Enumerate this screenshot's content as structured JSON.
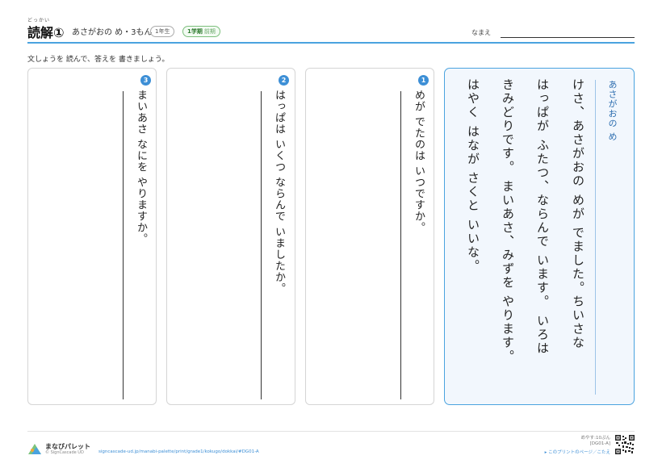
{
  "header": {
    "title_ruby": "どっかい",
    "title": "読解①",
    "subtitle": "あさがおの め・3もん",
    "grade": "1年生",
    "term": "1学期",
    "term_sub": "前期",
    "name_label": "なまえ"
  },
  "instruction": "文しょうを 読んで、答えを 書きましょう。",
  "story": {
    "title": "あさがおの め",
    "lines": [
      "けさ、あさがおの めが でました。ちいさな",
      "はっぱが ふたつ、ならんで います。 いろは",
      "きみどりです。 まいあさ、みずを やります。",
      "はやく はなが さくと いいな。"
    ]
  },
  "questions": [
    {
      "number": "1",
      "text": "めが でたのは いつですか。"
    },
    {
      "number": "2",
      "text": "はっぱは いくつ ならんで いましたか。"
    },
    {
      "number": "3",
      "text": "まいあさ なにを やりますか。"
    }
  ],
  "footer": {
    "brand": "まなびパレット",
    "copyright": "© SignCascade UD",
    "url": "signcascade-ud.jp/manabi-palette/print/grade1/kokugo/dokkai/#DG01-A",
    "reading_time": "めやす:10ぷん",
    "code": "[DG01-A]",
    "answer_link": "▸ このプリントのページ／こたえ"
  },
  "colors": {
    "accent": "#4aa3df",
    "number_badge": "#3d8fd6",
    "story_bg": "#f2f7fd",
    "story_title": "#2f6fb0"
  }
}
